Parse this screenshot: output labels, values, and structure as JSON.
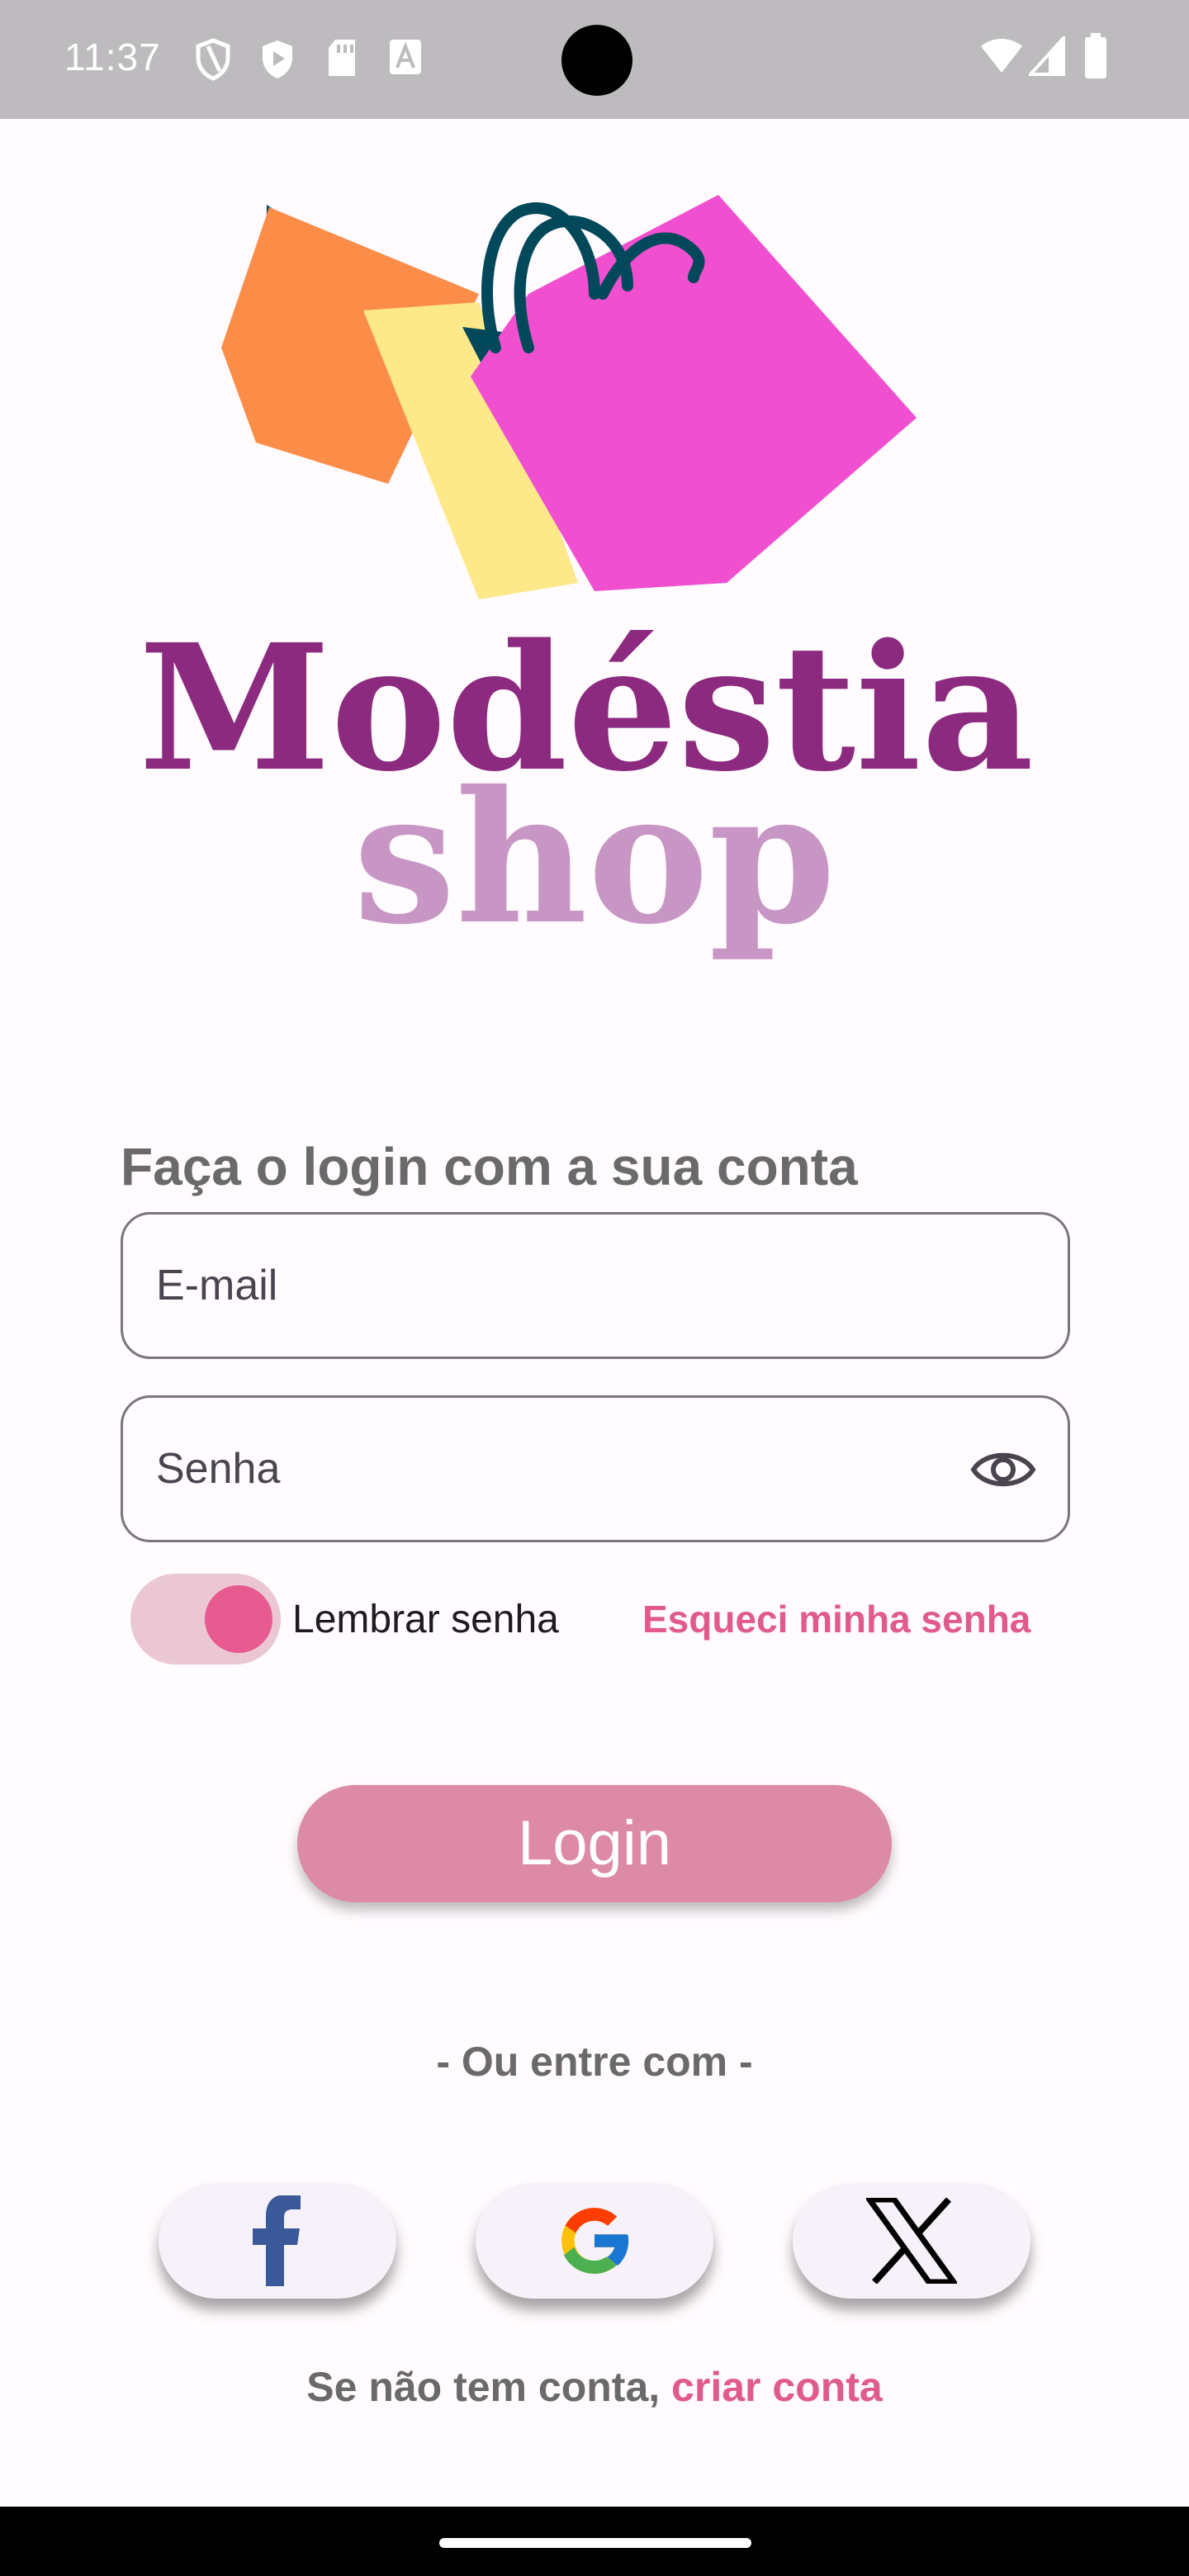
{
  "status_bar": {
    "time": "11:37",
    "icons": [
      "shield-icon",
      "play-protect-icon",
      "sd-card-icon",
      "font-icon",
      "wifi-icon",
      "signal-icon",
      "battery-icon"
    ]
  },
  "logo": {
    "line1": "Modéstia",
    "line2": "shop"
  },
  "login": {
    "heading": "Faça o login com a sua conta",
    "email_placeholder": "E-mail",
    "password_placeholder": "Senha",
    "remember_label": "Lembrar senha",
    "remember_on": true,
    "forgot_label": "Esqueci minha senha",
    "login_button": "Login"
  },
  "social": {
    "divider": "- Ou entre com -",
    "providers": [
      "facebook-icon",
      "google-icon",
      "x-icon"
    ]
  },
  "signup": {
    "prefix": "Se não tem conta, ",
    "link": "criar conta"
  },
  "colors": {
    "accent": "#e05a8e",
    "login_button": "#dd8aa7",
    "logo_purple": "#8b2a7e",
    "logo_light": "#c896c4"
  }
}
